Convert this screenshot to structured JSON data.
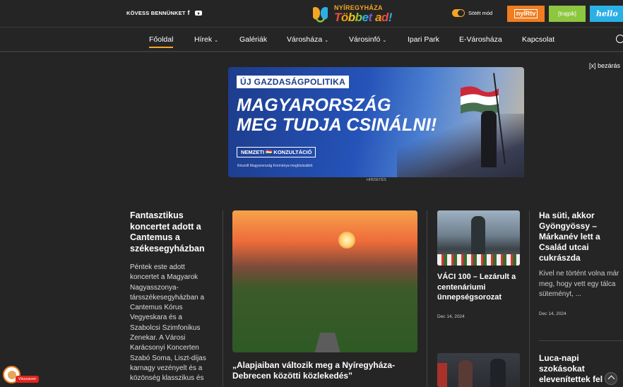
{
  "topbar": {
    "follow_label": "KÖVESS BENNÜNKET",
    "facebook": "f",
    "logo_top": "NYÍREGYHÁZA",
    "logo_main": [
      "T",
      "ö",
      "b",
      "b",
      "e",
      "t",
      " ",
      "a",
      "d",
      "!"
    ],
    "dark_mode_label": "Sötét mód",
    "partners": [
      "nyÍRtv",
      "[trajpik]",
      "hello"
    ]
  },
  "nav": {
    "items": [
      "Főoldal",
      "Hírek",
      "Galériák",
      "Városháza",
      "Városinfó",
      "Ipari Park",
      "E-Városháza",
      "Kapcsolat"
    ],
    "caret": "⌄"
  },
  "ad": {
    "close_label": "[x] bezárás",
    "tag": "ÚJ GAZDASÁGPOLITIKA",
    "headline_1": "MAGYARORSZÁG",
    "headline_2": "MEG TUDJA CSINÁLNI!",
    "consult": "NEMZETI 🇭🇺 KONZULTÁCIÓ",
    "small_print": "Készült Magyarország Kormánya megbízásából.",
    "label": "HIRDETÉS"
  },
  "articles": {
    "left": {
      "title": "Fantasztikus koncertet adott a Cantemus a székesegyházban",
      "excerpt": "Péntek este adott koncertet a Magyarok Nagyasszonya-társszékesegyházban a Cantemus Kórus Vegyeskara és a Szabolcsi Szimfonikus Zenekar. A Városi Karácsonyi Koncerten Szabó Soma, Liszt-díjas karnagy vezényelt és a közönség klasszikus és"
    },
    "feature": {
      "title": "„Alapjaiban változik meg a Nyíregyháza-Debrecen közötti közlekedés”"
    },
    "col3": {
      "title": "VÁCI 100 – Lezárult a centenáriumi ünnepségsorozat",
      "date": "Dec 14, 2024"
    },
    "col4": {
      "title": "Ha süti, akkor Gyöngyössy – Márkanév lett a Család utcai cukrászda",
      "excerpt": "Kivel ne történt volna már meg, hogy vett egy tálca süteményt, ...",
      "date": "Dec 14, 2024"
    },
    "col4b": {
      "title": "Luca-napi szokásokat elevenítettek fel az"
    }
  },
  "cookie": {
    "revoke_label": "Visszavon"
  }
}
